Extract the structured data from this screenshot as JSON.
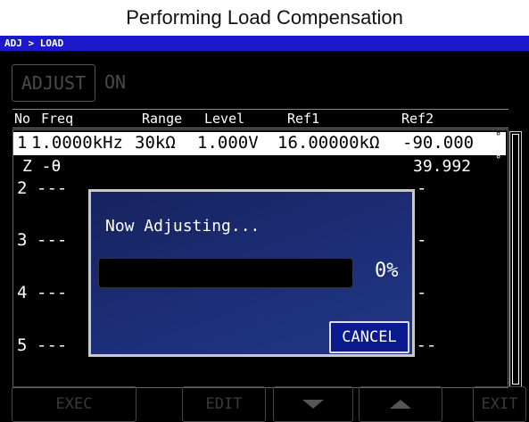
{
  "caption": "Performing Load Compensation",
  "breadcrumb": "ADJ > LOAD",
  "adjust": {
    "label": "ADJUST",
    "value": "ON"
  },
  "table": {
    "headers": {
      "no": "No",
      "freq": "Freq",
      "range": "Range",
      "level": "Level",
      "ref1": "Ref1",
      "ref2": "Ref2"
    },
    "rows": [
      {
        "no": "1",
        "freq": "1.0000kHz",
        "range": "30kΩ",
        "level": "1.000V",
        "ref1": "16.00000kΩ",
        "ref2": "-90.000",
        "unit": "°"
      },
      {
        "no": "2",
        "freq": "---",
        "range": "",
        "level": "",
        "ref1": "",
        "ref2": "",
        "unit": ""
      },
      {
        "no": "3",
        "freq": "---",
        "range": "",
        "level": "",
        "ref1": "",
        "ref2": "",
        "unit": ""
      },
      {
        "no": "4",
        "freq": "---",
        "range": "",
        "level": "",
        "ref1": "",
        "ref2": "",
        "unit": ""
      },
      {
        "no": "5",
        "freq": "---",
        "range": "---",
        "level": "---",
        "ref1": "---",
        "ref2": "---",
        "unit": ""
      }
    ],
    "z_label": "Z -θ",
    "z_value": "39.992",
    "z_unit": "°",
    "partial_dashes": [
      "-",
      "-",
      "-",
      "-"
    ]
  },
  "dialog": {
    "title": "Now Adjusting...",
    "progress_percent": 0,
    "progress_text": "0%",
    "cancel_label": "CANCEL"
  },
  "footer": {
    "exec": "EXEC",
    "edit": "EDIT",
    "exit": "EXIT",
    "down_icon": "triangle-down-icon",
    "up_icon": "triangle-up-icon"
  },
  "colors": {
    "breadcrumb_bg": "#1a1acc",
    "dialog_bg": "#1d2f7a",
    "cancel_bg": "#0b1a8e",
    "selected_row_bg": "#ffffff"
  }
}
